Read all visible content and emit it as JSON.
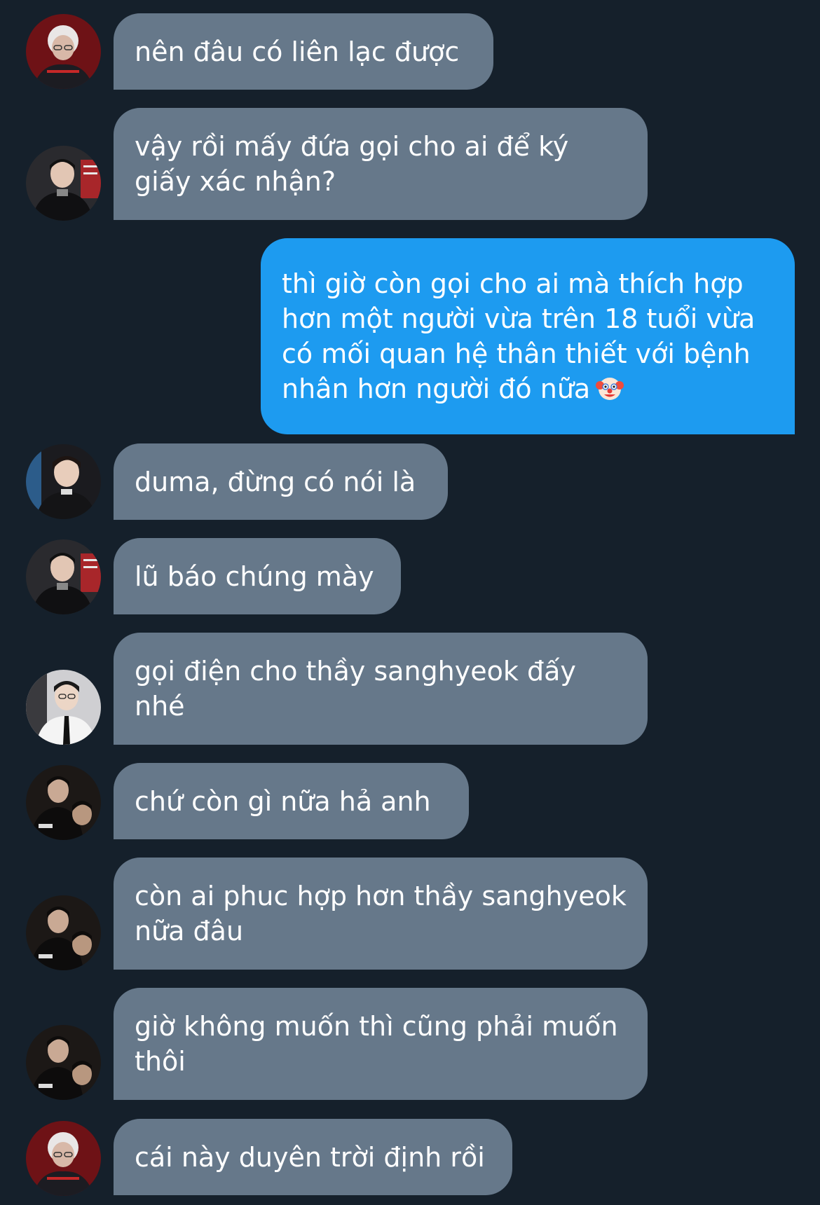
{
  "messages": [
    {
      "avatar_icon": "avatar-red-jersey-white-hair",
      "text": "nên đâu có liên lạc được"
    },
    {
      "avatar_icon": "avatar-black-suit",
      "text": "vậy rồi mấy đứa gọi cho ai để ký giấy xác nhận?"
    },
    {
      "text": "thì giờ còn gọi cho ai mà thích hợp hơn một người vừa trên 18 tuổi vừa có mối quan hệ thân thiết với bệnh nhân hơn người đó nữa",
      "emoji": "clown-face-icon"
    },
    {
      "avatar_icon": "avatar-dark-jacket-smile",
      "text": "duma, đừng có nói là"
    },
    {
      "avatar_icon": "avatar-black-suit",
      "text": "lũ báo chúng mày"
    },
    {
      "avatar_icon": "avatar-white-shirt-tie",
      "text": "gọi điện cho thầy sanghyeok đấy nhé"
    },
    {
      "avatar_icon": "avatar-dark-duo",
      "text": "chứ còn gì nữa hả anh"
    },
    {
      "avatar_icon": "avatar-dark-duo",
      "text": "còn ai phuc hợp hơn thầy sanghyeok nữa đâu"
    },
    {
      "avatar_icon": "avatar-dark-duo",
      "text": "giờ không muốn thì cũng phải muốn thôi"
    },
    {
      "avatar_icon": "avatar-red-jersey-white-hair",
      "text": "cái này duyên trời định rồi"
    }
  ],
  "colors": {
    "background": "#15202b",
    "incoming_bubble": "#66788a",
    "outgoing_bubble": "#1d9bf0",
    "text": "#ffffff"
  }
}
